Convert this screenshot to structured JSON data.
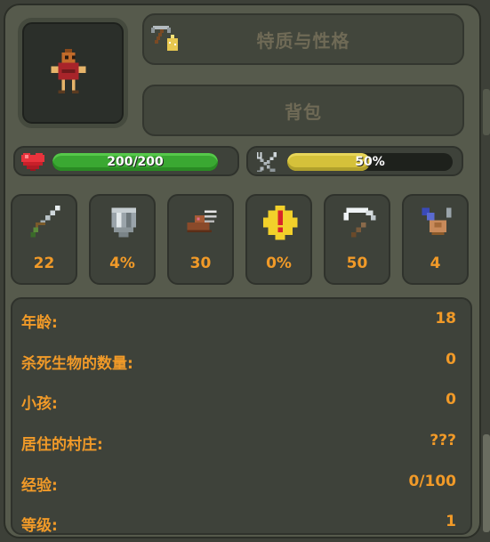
{
  "buttons": {
    "traits": "特质与性格",
    "bag": "背包"
  },
  "health": {
    "text": "200/200",
    "fraction": 1.0,
    "icon": "heart-icon",
    "color": "#3aa832"
  },
  "hunger": {
    "text": "50%",
    "fraction": 0.5,
    "icon": "fork-knife-icon",
    "color": "#d5c13a"
  },
  "stats": [
    {
      "icon": "sword-icon",
      "value": "22"
    },
    {
      "icon": "shield-icon",
      "value": "4%"
    },
    {
      "icon": "winged-boot-icon",
      "value": "30"
    },
    {
      "icon": "critical-star-icon",
      "value": "0%"
    },
    {
      "icon": "scythe-icon",
      "value": "50"
    },
    {
      "icon": "range-hand-icon",
      "value": "4"
    }
  ],
  "info": [
    {
      "label": "年龄:",
      "value": "18"
    },
    {
      "label": "杀死生物的数量:",
      "value": "0"
    },
    {
      "label": "小孩:",
      "value": "0"
    },
    {
      "label": "居住的村庄:",
      "value": "???"
    },
    {
      "label": "经验:",
      "value": "0/100"
    },
    {
      "label": "等级:",
      "value": "1"
    }
  ],
  "accent_color": "#f19a28"
}
